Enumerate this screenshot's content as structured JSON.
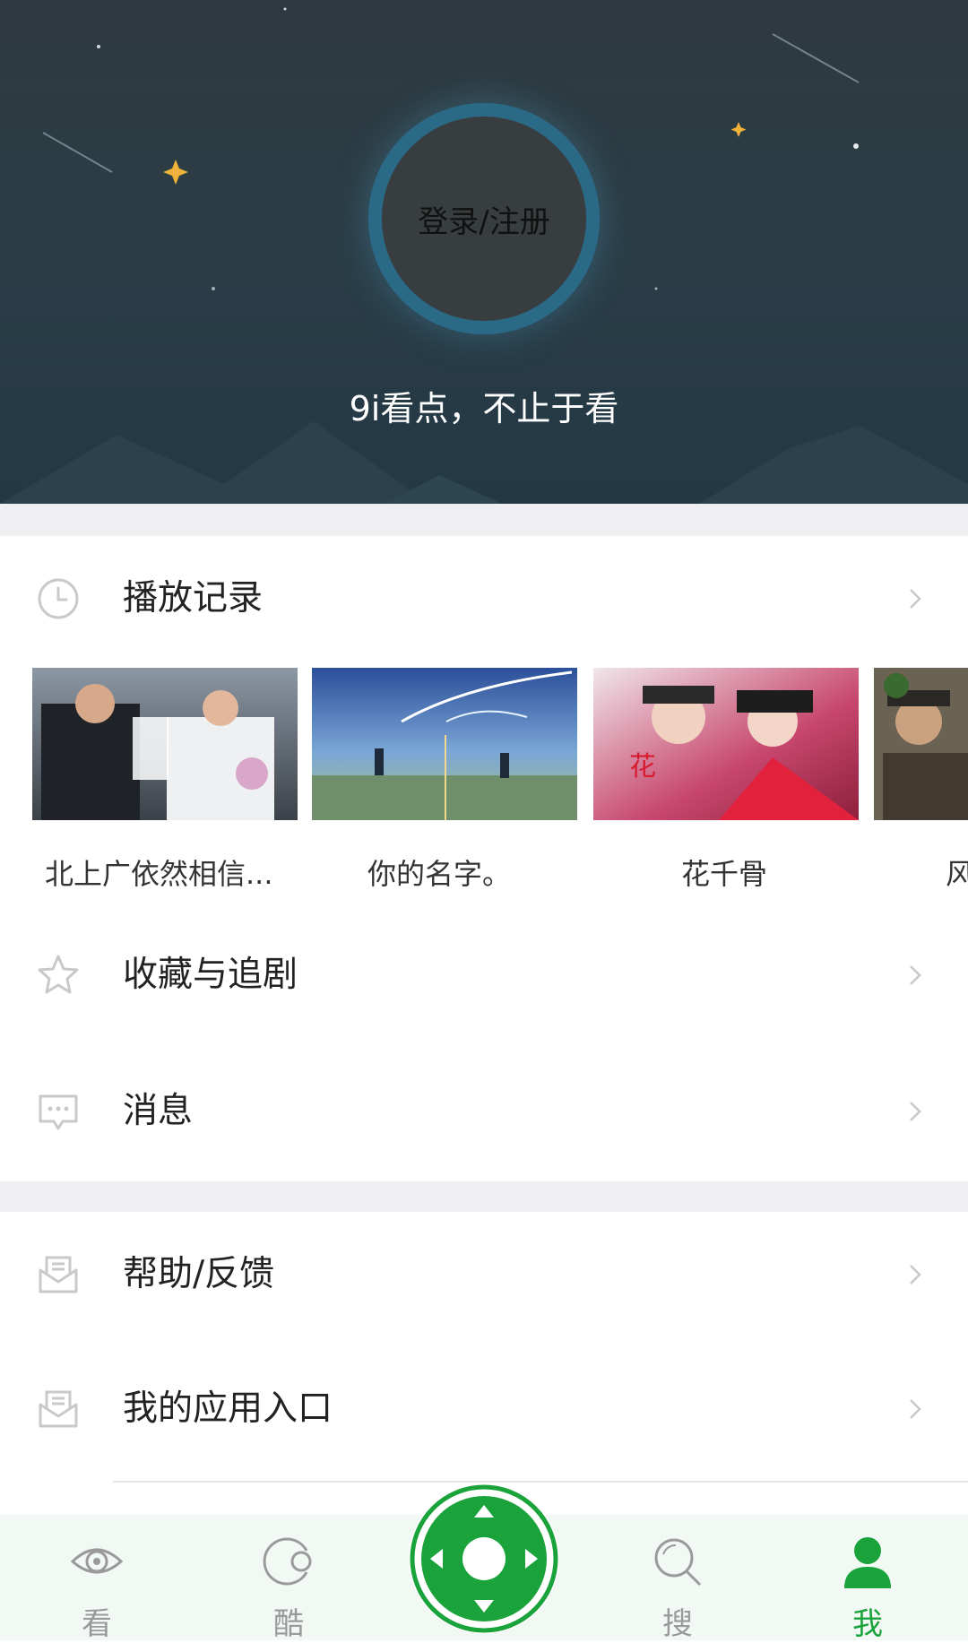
{
  "header": {
    "login_label": "登录/注册",
    "slogan": "9i看点，不止于看"
  },
  "menu": {
    "history_label": "播放记录",
    "favorites_label": "收藏与追剧",
    "messages_label": "消息",
    "help_label": "帮助/反馈",
    "apps_label": "我的应用入口"
  },
  "history": [
    {
      "title": "北上广依然相信..."
    },
    {
      "title": "你的名字。"
    },
    {
      "title": "花千骨"
    },
    {
      "title": "风"
    }
  ],
  "tabs": [
    {
      "label": "看",
      "icon": "eye-icon"
    },
    {
      "label": "酷",
      "icon": "cool-icon"
    },
    {
      "label": "搜",
      "icon": "search-icon"
    },
    {
      "label": "我",
      "icon": "person-icon",
      "active": true
    }
  ],
  "colors": {
    "accent": "#1aa33a",
    "hero_bg": "#2a3d47",
    "inactive_tab": "#9a9a9a"
  }
}
